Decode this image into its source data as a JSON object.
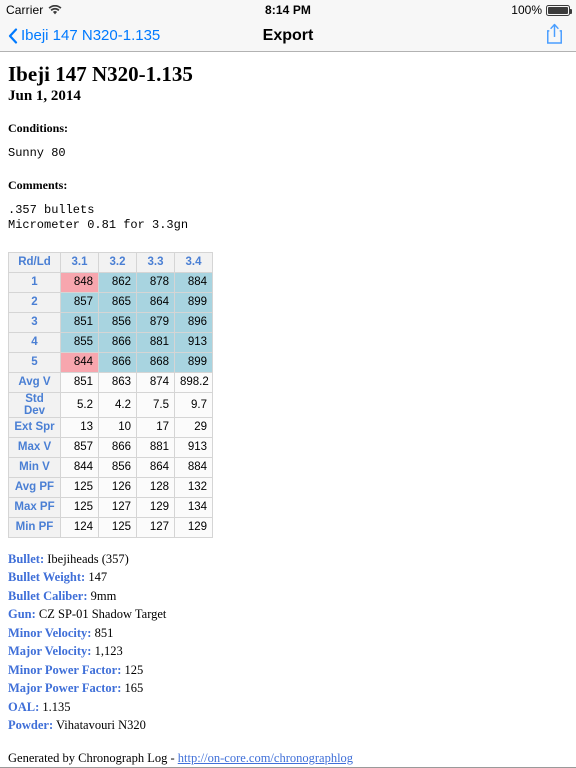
{
  "status_bar": {
    "carrier": "Carrier",
    "wifi_icon": "wifi-icon",
    "time": "8:14 PM",
    "battery_percent": "100%",
    "battery_icon": "battery-full-icon"
  },
  "nav_bar": {
    "back_icon": "chevron-left-icon",
    "back_label": "Ibeji 147 N320-1.135",
    "title": "Export",
    "share_icon": "share-icon"
  },
  "document": {
    "title": "Ibeji 147 N320-1.135",
    "date": "Jun 1, 2014",
    "conditions_label": "Conditions:",
    "conditions_value": "Sunny 80",
    "comments_label": "Comments:",
    "comments_value": ".357 bullets\nMicrometer 0.81 for 3.3gn"
  },
  "table": {
    "corner_header": "Rd/Ld",
    "columns": [
      "3.1",
      "3.2",
      "3.3",
      "3.4"
    ],
    "shot_rows": [
      {
        "label": "1",
        "values": [
          "848",
          "862",
          "878",
          "884"
        ],
        "styles": [
          "red",
          "blue",
          "blue",
          "blue"
        ]
      },
      {
        "label": "2",
        "values": [
          "857",
          "865",
          "864",
          "899"
        ],
        "styles": [
          "blue",
          "blue",
          "blue",
          "blue"
        ]
      },
      {
        "label": "3",
        "values": [
          "851",
          "856",
          "879",
          "896"
        ],
        "styles": [
          "blue",
          "blue",
          "blue",
          "blue"
        ]
      },
      {
        "label": "4",
        "values": [
          "855",
          "866",
          "881",
          "913"
        ],
        "styles": [
          "blue",
          "blue",
          "blue",
          "blue"
        ]
      },
      {
        "label": "5",
        "values": [
          "844",
          "866",
          "868",
          "899"
        ],
        "styles": [
          "red",
          "blue",
          "blue",
          "blue"
        ]
      }
    ],
    "summary_rows": [
      {
        "label": "Avg V",
        "values": [
          "851",
          "863",
          "874",
          "898.2"
        ]
      },
      {
        "label": "Std Dev",
        "values": [
          "5.2",
          "4.2",
          "7.5",
          "9.7"
        ]
      },
      {
        "label": "Ext Spr",
        "values": [
          "13",
          "10",
          "17",
          "29"
        ]
      },
      {
        "label": "Max V",
        "values": [
          "857",
          "866",
          "881",
          "913"
        ]
      },
      {
        "label": "Min V",
        "values": [
          "844",
          "856",
          "864",
          "884"
        ]
      },
      {
        "label": "Avg PF",
        "values": [
          "125",
          "126",
          "128",
          "132"
        ]
      },
      {
        "label": "Max PF",
        "values": [
          "125",
          "127",
          "129",
          "134"
        ]
      },
      {
        "label": "Min PF",
        "values": [
          "124",
          "125",
          "127",
          "129"
        ]
      }
    ],
    "colors": {
      "highlight_red": "#f7a6ae",
      "cell_blue": "#a8d4e0",
      "header_text": "#4a7fd4"
    }
  },
  "metadata": [
    {
      "key": "Bullet:",
      "value": "Ibejiheads (357)"
    },
    {
      "key": "Bullet Weight:",
      "value": "147"
    },
    {
      "key": "Bullet Caliber:",
      "value": "9mm"
    },
    {
      "key": "Gun:",
      "value": "CZ SP-01 Shadow Target"
    },
    {
      "key": "Minor Velocity:",
      "value": "851"
    },
    {
      "key": "Major Velocity:",
      "value": "1,123"
    },
    {
      "key": "Minor Power Factor:",
      "value": "125"
    },
    {
      "key": "Major Power Factor:",
      "value": "165"
    },
    {
      "key": "OAL:",
      "value": "1.135"
    },
    {
      "key": "Powder:",
      "value": "Vihatavouri N320"
    }
  ],
  "footer": {
    "prefix": "Generated by Chronograph Log - ",
    "link_text": "http://on-core.com/chronographlog"
  }
}
